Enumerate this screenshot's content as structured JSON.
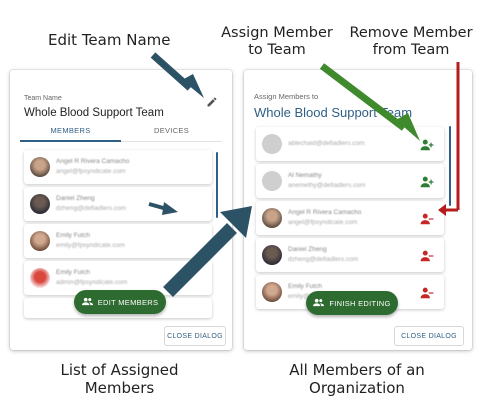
{
  "callouts": {
    "edit_team_name": "Edit Team Name",
    "assign_member": "Assign Member to Team",
    "remove_member": "Remove Member from Team",
    "list_assigned": "List of Assigned Members",
    "all_members": "All Members of an Organization"
  },
  "left_panel": {
    "team_name_label": "Team Name",
    "team_name": "Whole Blood Support Team",
    "tabs": [
      {
        "label": "MEMBERS",
        "active": true
      },
      {
        "label": "DEVICES",
        "active": false
      }
    ],
    "members": [
      {
        "name": "Angel R Rivera Camacho",
        "email": "angel@fpsyndicate.com"
      },
      {
        "name": "Daniel Zheng",
        "email": "dzheng@defiadlers.com"
      },
      {
        "name": "Emily Futch",
        "email": "emily@fpsyndicate.com"
      },
      {
        "name": "Emily Futch",
        "email": "admin@fpsyndicate.com"
      }
    ],
    "edit_members_label": "EDIT MEMBERS",
    "close_label": "CLOSE DIALOG"
  },
  "right_panel": {
    "label": "Assign Members to",
    "team_name": "Whole Blood Support Team",
    "members": [
      {
        "name": "",
        "email": "ablechaid@defiadlers.com",
        "action": "assign"
      },
      {
        "name": "Al Nemathy",
        "email": "anemethy@defiadlers.com",
        "action": "assign"
      },
      {
        "name": "Angel R Rivera Camacho",
        "email": "angel@fpsyndicate.com",
        "action": "remove"
      },
      {
        "name": "Daniel Zheng",
        "email": "dzheng@defiadlers.com",
        "action": "remove"
      },
      {
        "name": "Emily Futch",
        "email": "emily@fpsyndicate.com",
        "action": "remove"
      }
    ],
    "finish_label": "FINISH EDITING",
    "close_label": "CLOSE DIALOG"
  },
  "colors": {
    "accent_blue": "#2f5f86",
    "button_green": "#2e6b30",
    "assign_green": "#2e7d32",
    "remove_red": "#c62828",
    "arrow_teal": "#2c5266",
    "arrow_green": "#3f8a2c",
    "arrow_red": "#b71c1c"
  },
  "icons": {
    "edit": "pencil-icon",
    "assign": "person-add-icon",
    "remove": "person-remove-icon",
    "group": "group-icon"
  }
}
